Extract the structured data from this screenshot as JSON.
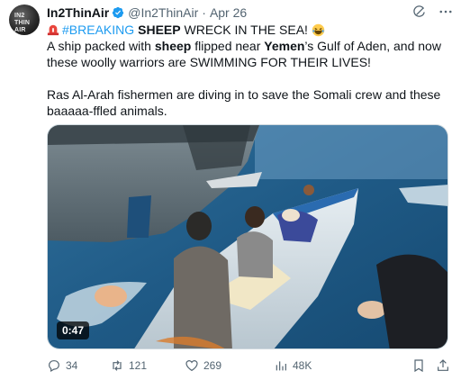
{
  "author": {
    "display_name": "In2ThinAir",
    "handle": "@In2ThinAir",
    "separator": "·",
    "date": "Apr 26",
    "avatar_text": "IN2 THIN AIR"
  },
  "tweet": {
    "hashtag": "#BREAKING",
    "line1_bold": "SHEEP",
    "line1_rest": "WRECK IN THE SEA!",
    "line2_a": "A ship packed with",
    "line2_b": "sheep",
    "line2_c": "flipped near",
    "line2_d": "Yemen",
    "line2_e": "’s Gulf of Aden, and now",
    "line3": "these woolly warriors are SWIMMING FOR THEIR LIVES!",
    "para2_line1": "Ras Al-Arah fishermen are diving in to save the Somali crew and these",
    "para2_line2": "baaaaa-ffled animals."
  },
  "video": {
    "duration": "0:47"
  },
  "actions": {
    "replies": "34",
    "reposts": "121",
    "likes": "269",
    "views": "48K"
  },
  "colors": {
    "accent": "#1d9bf0",
    "secondary_text": "#536471",
    "primary_text": "#0f1419"
  },
  "icons": [
    "verified-badge-icon",
    "grok-icon",
    "more-icon",
    "siren-icon",
    "laughing-emoji-icon",
    "reply-icon",
    "repost-icon",
    "like-icon",
    "views-icon",
    "bookmark-icon",
    "share-icon"
  ]
}
